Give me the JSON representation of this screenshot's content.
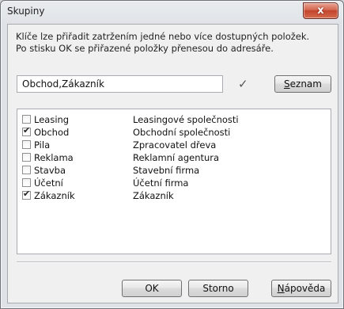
{
  "window": {
    "title": "Skupiny",
    "close_glyph": "x"
  },
  "description": [
    "Klíče lze přiřadit zatržením jedné nebo více dostupných položek.",
    "Po stisku OK se přiřazené položky přenesou do adresáře."
  ],
  "selection_field": {
    "value": "Obchod,Zákazník"
  },
  "confirm_icon": "✓",
  "buttons": {
    "seznam": {
      "accel": "S",
      "rest": "eznam"
    },
    "ok": "OK",
    "storno": "Storno",
    "napoveda": {
      "accel": "N",
      "rest": "ápověda"
    }
  },
  "list": {
    "items": [
      {
        "code": "Leasing",
        "name": "Leasingové společnosti",
        "checked": false
      },
      {
        "code": "Obchod",
        "name": "Obchodní společnosti",
        "checked": true
      },
      {
        "code": "Pila",
        "name": "Zpracovatel dřeva",
        "checked": false
      },
      {
        "code": "Reklama",
        "name": "Reklamní agentura",
        "checked": false
      },
      {
        "code": "Stavba",
        "name": "Stavební firma",
        "checked": false
      },
      {
        "code": "Účetní",
        "name": "Účetní firma",
        "checked": false
      },
      {
        "code": "Zákazník",
        "name": "Zákazník",
        "checked": true
      }
    ]
  }
}
